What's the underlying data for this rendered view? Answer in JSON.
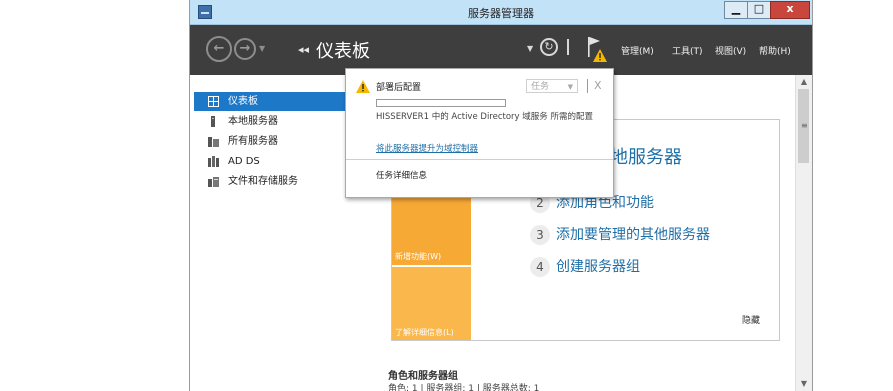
{
  "window": {
    "title": "服务器管理器",
    "controls": {
      "minimize": "▁",
      "maximize": "□",
      "close": "x"
    }
  },
  "header": {
    "breadcrumb_arrows": "◂◂",
    "page_title": "仪表板",
    "menus": [
      "管理(M)",
      "工具(T)",
      "视图(V)",
      "帮助(H)"
    ],
    "notification_flag_status": "warning"
  },
  "sidebar": {
    "items": [
      {
        "label": "仪表板",
        "icon": "dashboard-icon",
        "selected": true
      },
      {
        "label": "本地服务器",
        "icon": "server-icon",
        "selected": false
      },
      {
        "label": "所有服务器",
        "icon": "servers-icon",
        "selected": false
      },
      {
        "label": "AD DS",
        "icon": "ad-ds-icon",
        "selected": false
      },
      {
        "label": "文件和存储服务",
        "icon": "file-storage-icon",
        "selected": false
      }
    ]
  },
  "quick_start": {
    "heading": "地服务器",
    "steps": [
      {
        "num": "2",
        "label": "添加角色和功能"
      },
      {
        "num": "3",
        "label": "添加要管理的其他服务器"
      },
      {
        "num": "4",
        "label": "创建服务器组"
      }
    ],
    "left_labels": {
      "whats_new": "新增功能(W)",
      "learn_more": "了解详细信息(L)"
    },
    "hide": "隐藏"
  },
  "roles": {
    "title": "角色和服务器组",
    "subtitle": "角色: 1 | 服务器组: 1 | 服务器总数: 1"
  },
  "notification_popup": {
    "title": "部署后配置",
    "task_button": "任务",
    "close": "X",
    "progress": 0.0,
    "message": "HISSERVER1 中的 Active Directory 域服务 所需的配置",
    "link": "将此服务器提升为域控制器",
    "details": "任务详细信息"
  },
  "colors": {
    "header_bg": "#3e3e3e",
    "selected_nav": "#1e78c8",
    "quick_start_orange": "#f7a936",
    "link_blue": "#1f6fa7",
    "warning_yellow": "#f5b800"
  }
}
